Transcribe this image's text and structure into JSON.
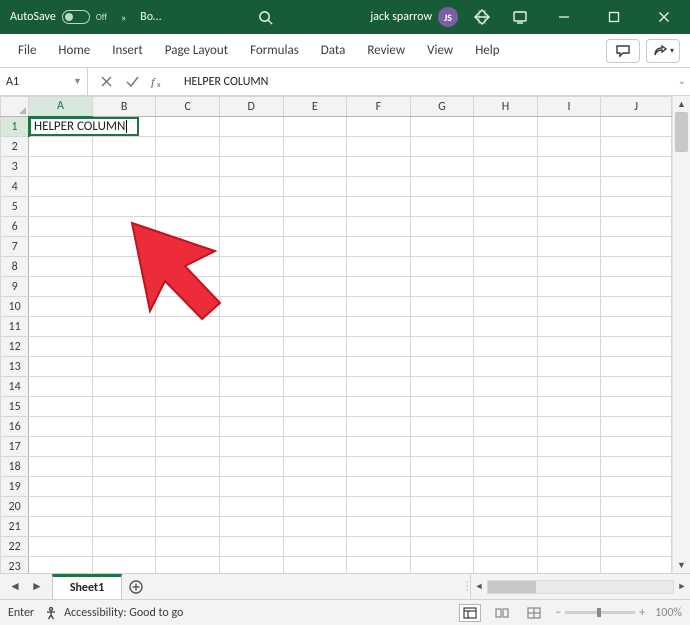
{
  "titlebar": {
    "autosave_label": "AutoSave",
    "autosave_state": "Off",
    "doc_name": "Bo…",
    "user_name": "jack sparrow",
    "user_initials": "JS"
  },
  "ribbon": {
    "tabs": [
      "File",
      "Home",
      "Insert",
      "Page Layout",
      "Formulas",
      "Data",
      "Review",
      "View",
      "Help"
    ]
  },
  "namebox": {
    "ref": "A1"
  },
  "formula_bar": {
    "value": "HELPER COLUMN"
  },
  "grid": {
    "columns": [
      "A",
      "B",
      "C",
      "D",
      "E",
      "F",
      "G",
      "H",
      "I",
      "J"
    ],
    "row_count": 23,
    "active_cell": "A1",
    "cells": {
      "A1": "HELPER COLUMN"
    }
  },
  "sheets": {
    "active": "Sheet1"
  },
  "statusbar": {
    "mode": "Enter",
    "accessibility": "Accessibility: Good to go",
    "zoom_label": "100%"
  }
}
